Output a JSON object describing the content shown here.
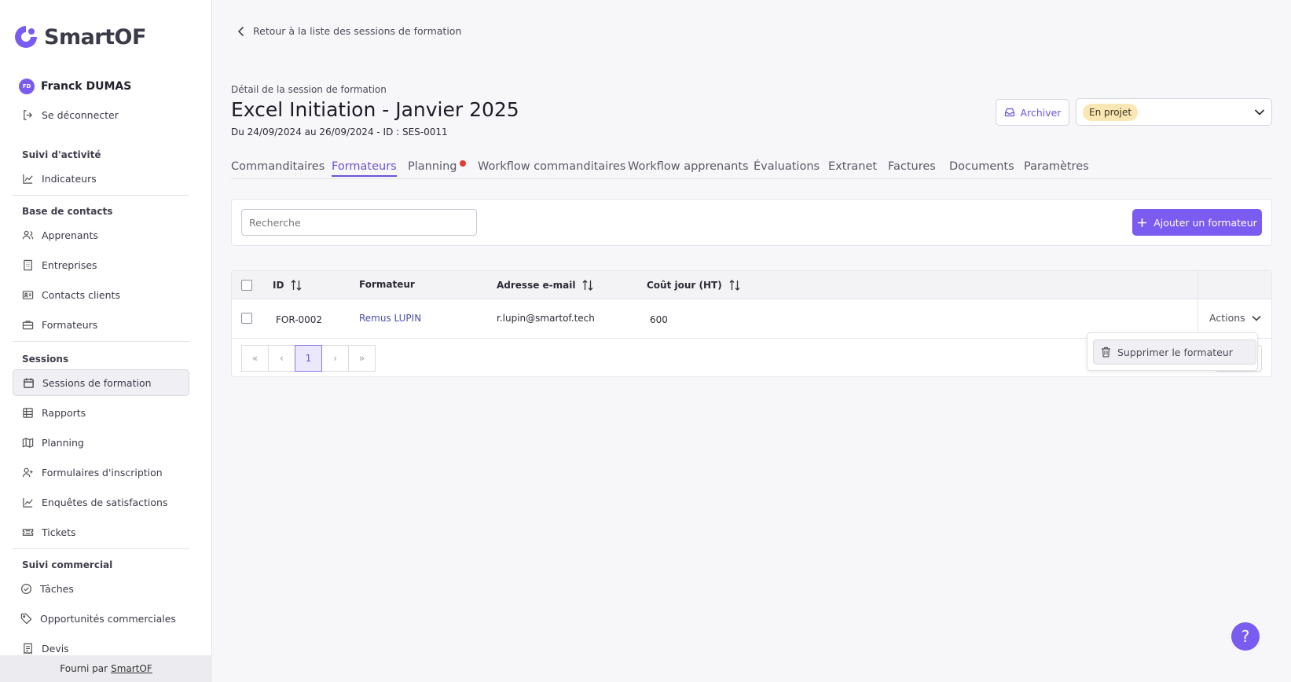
{
  "app": {
    "logo_text": "SmartOF",
    "brand_color": "#7b5cf0"
  },
  "user": {
    "initials": "FD",
    "name": "Franck DUMAS"
  },
  "sidebar": {
    "logout": "Se déconnecter",
    "sections": {
      "activity": "Suivi d'activité",
      "contacts": "Base de contacts",
      "sessions": "Sessions",
      "commercial": "Suivi commercial"
    },
    "items": {
      "indicators": "Indicateurs",
      "learners": "Apprenants",
      "companies": "Entreprises",
      "client_contacts": "Contacts clients",
      "trainers": "Formateurs",
      "training_sessions": "Sessions de formation",
      "reports": "Rapports",
      "planning": "Planning",
      "registration_forms": "Formulaires d'inscription",
      "surveys": "Enquêtes de satisfactions",
      "tickets": "Tickets",
      "tasks": "Tâches",
      "opportunities": "Opportunités commerciales",
      "quotes": "Devis"
    },
    "footer": {
      "prefix": "Fourni par",
      "link": "SmartOF"
    }
  },
  "header": {
    "back": "Retour à la liste des sessions de formation",
    "subtitle": "Détail de la session de formation",
    "title": "Excel Initiation - Janvier 2025",
    "dates": "Du 24/09/2024 au 26/09/2024 - ID : SES-0011",
    "archive": "Archiver",
    "status": "En projet"
  },
  "tabs": [
    {
      "label": "Commanditaires"
    },
    {
      "label": "Formateurs",
      "active": true
    },
    {
      "label": "Planning",
      "alert": true
    },
    {
      "label": "Workflow commanditaires"
    },
    {
      "label": "Workflow apprenants"
    },
    {
      "label": "Évaluations"
    },
    {
      "label": "Extranet"
    },
    {
      "label": "Factures"
    },
    {
      "label": "Documents"
    },
    {
      "label": "Paramètres"
    }
  ],
  "search": {
    "placeholder": "Recherche"
  },
  "add_button": "Ajouter un formateur",
  "table": {
    "columns": {
      "id": "ID",
      "trainer": "Formateur",
      "email": "Adresse e-mail",
      "cost": "Coût jour (HT)"
    },
    "rows": [
      {
        "id": "FOR-0002",
        "trainer": "Remus LUPIN",
        "email": "r.lupin@smartof.tech",
        "cost": "600",
        "actions": "Actions"
      }
    ]
  },
  "pagination": {
    "current": "1"
  },
  "dropdown": {
    "delete": "Supprimer le formateur"
  },
  "help": "?"
}
